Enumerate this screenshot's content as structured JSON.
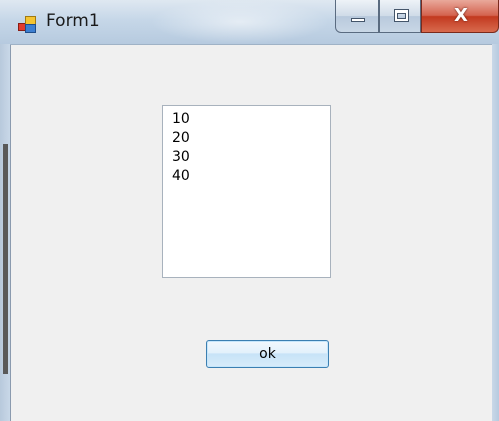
{
  "window": {
    "title": "Form1",
    "close_glyph": "X"
  },
  "icons": {
    "app": "windows-form-icon",
    "minimize": "minimize-icon",
    "maximize": "maximize-icon",
    "close": "close-icon"
  },
  "listbox": {
    "items": [
      {
        "label": "10"
      },
      {
        "label": "20"
      },
      {
        "label": "30"
      },
      {
        "label": "40"
      }
    ]
  },
  "buttons": {
    "ok_label": "ok"
  },
  "colors": {
    "client_background": "#f0f0f0",
    "close_button": "#c2391f",
    "button_border": "#3c7fb1"
  }
}
